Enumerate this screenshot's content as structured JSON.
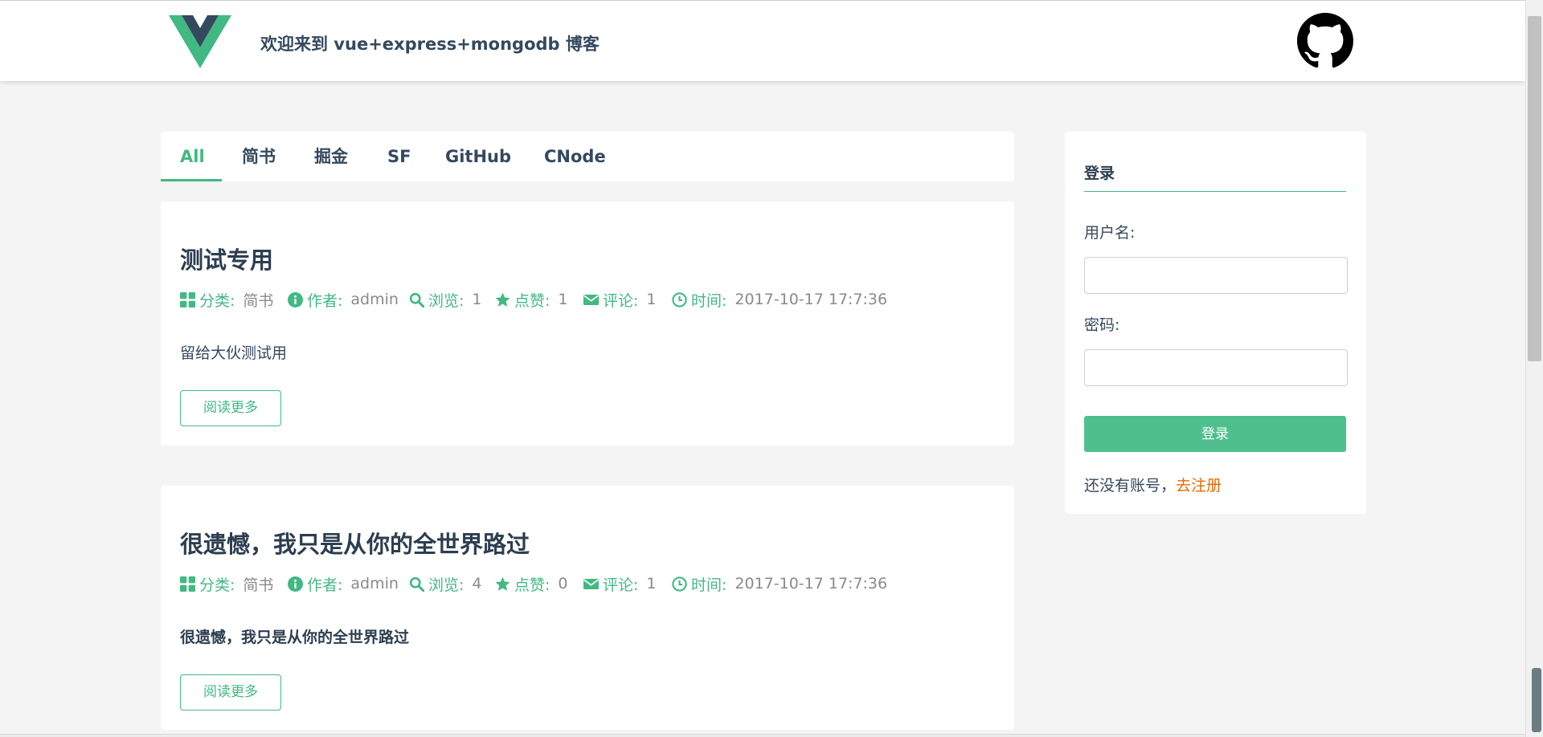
{
  "header": {
    "site_title": "欢迎来到 vue+express+mongodb 博客",
    "logo_icon": "vue-logo-icon",
    "github_icon": "github-icon",
    "accent_color": "#42b983"
  },
  "tabs": [
    {
      "label": "All",
      "active": true
    },
    {
      "label": "简书",
      "active": false
    },
    {
      "label": "掘金",
      "active": false
    },
    {
      "label": "SF",
      "active": false
    },
    {
      "label": "GitHub",
      "active": false
    },
    {
      "label": "CNode",
      "active": false
    }
  ],
  "meta_labels": {
    "category": "分类:",
    "author": "作者:",
    "views": "浏览:",
    "likes": "点赞:",
    "comments": "评论:",
    "time": "时间:"
  },
  "posts": [
    {
      "title": "测试专用",
      "category": "简书",
      "author": "admin",
      "views": "1",
      "likes": "1",
      "comments": "1",
      "time": "2017-10-17 17:7:36",
      "excerpt": "留给大伙测试用",
      "read_more": "阅读更多"
    },
    {
      "title": "很遗憾，我只是从你的全世界路过",
      "category": "简书",
      "author": "admin",
      "views": "4",
      "likes": "0",
      "comments": "1",
      "time": "2017-10-17 17:7:36",
      "excerpt": "很遗憾，我只是从你的全世界路过",
      "read_more": "阅读更多"
    }
  ],
  "login": {
    "heading": "登录",
    "username_label": "用户名:",
    "username_value": "",
    "password_label": "密码:",
    "password_value": "",
    "submit_label": "登录",
    "signup_prompt": "还没有账号，",
    "signup_link": "去注册",
    "signup_link_color": "#e96900"
  }
}
